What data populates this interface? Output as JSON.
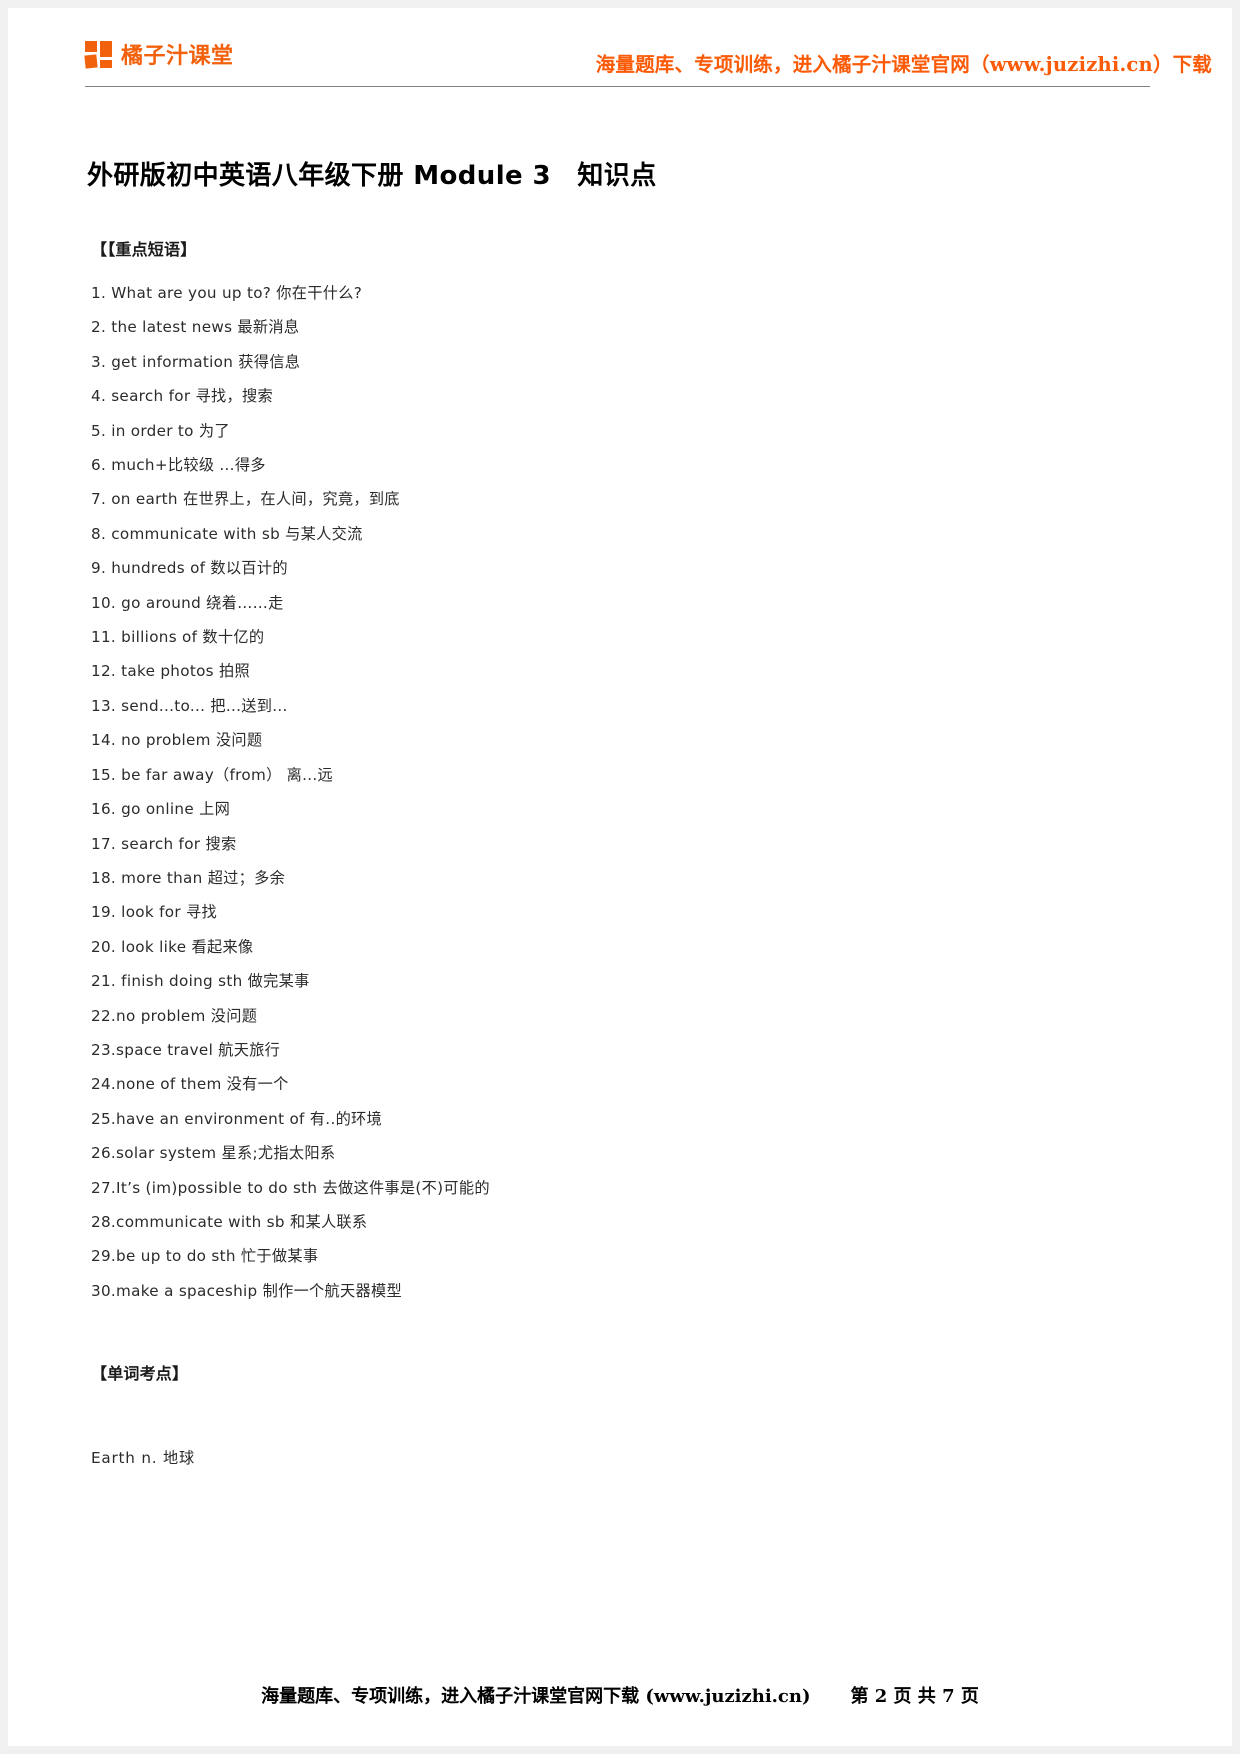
{
  "header": {
    "brand_name": "橘子汁课堂",
    "logo_icon": "orange-squares-logo-icon",
    "slogan": "海量题库、专项训练，进入橘子汁课堂官网（www.juzizhi.cn）下载",
    "brand_color": "#f2610c",
    "slogan_color": "#fb5a07"
  },
  "document": {
    "title": "外研版初中英语八年级下册 Module 3　知识点",
    "sections": [
      {
        "heading": "【【重点短语】",
        "items": [
          "1. What are you up to?  你在干什么?",
          "2. the latest news  最新消息",
          "3. get information  获得信息",
          "4. search for  寻找，搜索",
          "5. in order to  为了",
          "6. much+比较级  ...得多",
          "7. on earth  在世界上，在人间，究竟，到底",
          "8. communicate with sb  与某人交流",
          "9. hundreds of  数以百计的",
          "10. go around   绕着……走",
          "11. billions of  数十亿的",
          "12. take photos  拍照",
          "13. send...to...  把...送到...",
          "14. no problem  没问题",
          "15. be far away（from）  离...远",
          "16. go online  上网",
          "17. search for  搜索",
          "18. more than  超过；多余",
          "19. look for  寻找",
          "20. look like  看起来像",
          "21. finish doing sth  做完某事",
          "22.no problem  没问题",
          "23.space travel  航天旅行",
          "24.none of them  没有一个",
          "25.have an environment of 有..的环境",
          "26.solar system  星系;尤指太阳系",
          "27.It’s (im)possible to do sth  去做这件事是(不)可能的",
          "28.communicate with sb  和某人联系",
          "29.be up to do sth  忙于做某事",
          "30.make a spaceship  制作一个航天器模型"
        ]
      },
      {
        "heading": "【单词考点】",
        "items": [
          "Earth  n.  地球"
        ]
      }
    ]
  },
  "footer": {
    "note": "海量题库、专项训练，进入橘子汁课堂官网下载 (www.juzizhi.cn)",
    "page_label": "第 2 页 共 7 页"
  }
}
